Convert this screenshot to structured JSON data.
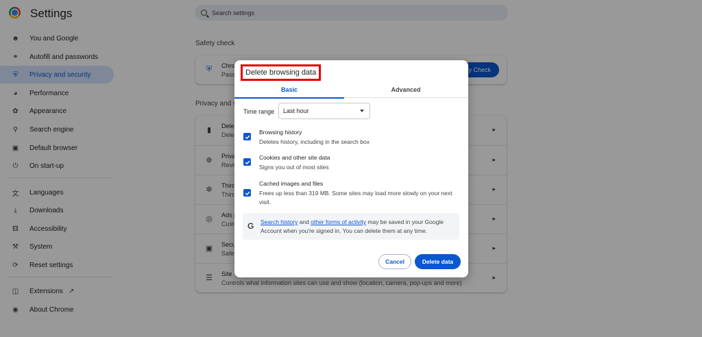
{
  "app": {
    "title": "Settings"
  },
  "search": {
    "placeholder": "Search settings"
  },
  "nav": {
    "items": [
      {
        "label": "You and Google",
        "icon": "person-icon"
      },
      {
        "label": "Autofill and passwords",
        "icon": "key-icon"
      },
      {
        "label": "Privacy and security",
        "icon": "shield-icon"
      },
      {
        "label": "Performance",
        "icon": "gauge-icon"
      },
      {
        "label": "Appearance",
        "icon": "palette-icon"
      },
      {
        "label": "Search engine",
        "icon": "search-icon"
      },
      {
        "label": "Default browser",
        "icon": "browser-icon"
      },
      {
        "label": "On start-up",
        "icon": "power-icon"
      },
      {
        "label": "Languages",
        "icon": "translate-icon"
      },
      {
        "label": "Downloads",
        "icon": "download-icon"
      },
      {
        "label": "Accessibility",
        "icon": "accessibility-icon"
      },
      {
        "label": "System",
        "icon": "wrench-icon"
      },
      {
        "label": "Reset settings",
        "icon": "reset-icon"
      },
      {
        "label": "Extensions",
        "icon": "puzzle-icon"
      },
      {
        "label": "About Chrome",
        "icon": "chrome-icon"
      }
    ]
  },
  "safety": {
    "section_title": "Safety check",
    "row_title": "Chrom",
    "row_sub": "Passw",
    "button": "ty Check"
  },
  "privacy": {
    "section_title": "Privacy and s",
    "rows": [
      {
        "title": "Dele",
        "sub": "Dele",
        "icon": "trash-icon"
      },
      {
        "title": "Priva",
        "sub": "Revie",
        "icon": "add-circle-icon"
      },
      {
        "title": "Third",
        "sub": "Third",
        "icon": "cookie-icon"
      },
      {
        "title": "Ads p",
        "sub": "Custo",
        "icon": "ads-icon"
      },
      {
        "title": "Secu",
        "sub": "Safe",
        "icon": "lock-icon"
      },
      {
        "title": "Site",
        "sub": "Controls what information sites can use and show (location, camera, pop-ups and more)",
        "icon": "sliders-icon"
      }
    ]
  },
  "dialog": {
    "title": "Delete browsing data",
    "tabs": [
      {
        "label": "Basic"
      },
      {
        "label": "Advanced"
      }
    ],
    "time_range_label": "Time range",
    "time_range_value": "Last hour",
    "options": [
      {
        "title": "Browsing history",
        "desc": "Deletes history, including in the search box",
        "checked": true
      },
      {
        "title": "Cookies and other site data",
        "desc": "Signs you out of most sites",
        "checked": true
      },
      {
        "title": "Cached images and files",
        "desc": "Frees up less than 319 MB. Some sites may load more slowly on your next visit.",
        "checked": true
      }
    ],
    "info": {
      "link1": "Search history",
      "and": " and ",
      "link2": "other forms of activity",
      "rest": " may be saved in your Google Account when you're signed in. You can delete them at any time."
    },
    "cancel": "Cancel",
    "delete": "Delete data"
  },
  "colors": {
    "accent": "#0b57d0",
    "highlight": "#e00000"
  }
}
